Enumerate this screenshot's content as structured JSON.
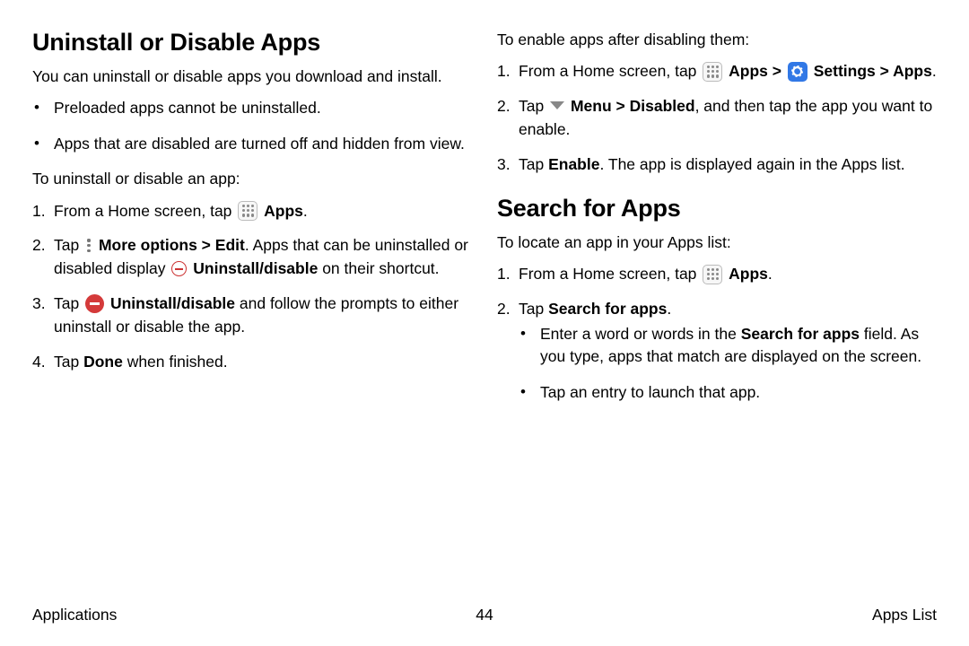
{
  "left": {
    "heading": "Uninstall or Disable Apps",
    "intro": "You can uninstall or disable apps you download and install.",
    "bullet1": "Preloaded apps cannot be uninstalled.",
    "bullet2": "Apps that are disabled are turned off and hidden from view.",
    "subhead": "To uninstall or disable an app:",
    "step1_a": "From a Home screen, tap ",
    "apps_label": "Apps",
    "step1_c": ".",
    "step2_a": "Tap ",
    "more_options": "More options",
    "chev": " > ",
    "edit": "Edit",
    "step2_b": ". Apps that can be uninstalled or disabled display ",
    "uninstall_disable": "Uninstall/disable",
    "step2_c": " on their shortcut.",
    "step3_a": "Tap ",
    "step3_b": " and follow the prompts to either uninstall or disable the app.",
    "step4_a": "Tap ",
    "done": "Done",
    "step4_b": " when finished."
  },
  "right": {
    "enable_intro": "To enable apps after disabling them:",
    "r1_a": "From a Home screen, tap ",
    "apps_label": "Apps",
    "chev": " > ",
    "settings": "Settings",
    "apps_bold2": "Apps",
    "r1_end": ".",
    "r2_a": "Tap ",
    "menu": "Menu",
    "disabled": "Disabled",
    "r2_b": ", and then tap the app you want to enable.",
    "r3_a": "Tap ",
    "enable": "Enable",
    "r3_b": ". The app is displayed again in the Apps list.",
    "heading2": "Search for Apps",
    "locate_intro": "To locate an app in your Apps list:",
    "s1_a": "From a Home screen, tap ",
    "s1_end": ".",
    "s2_a": "Tap ",
    "search_for_apps": "Search for apps",
    "s2_end": ".",
    "sub1_a": "Enter a word or words in the ",
    "sub1_b": " field. As you type, apps that match are displayed on the screen.",
    "sub2": "Tap an entry to launch that app."
  },
  "footer": {
    "left": "Applications",
    "center": "44",
    "right": "Apps List"
  }
}
